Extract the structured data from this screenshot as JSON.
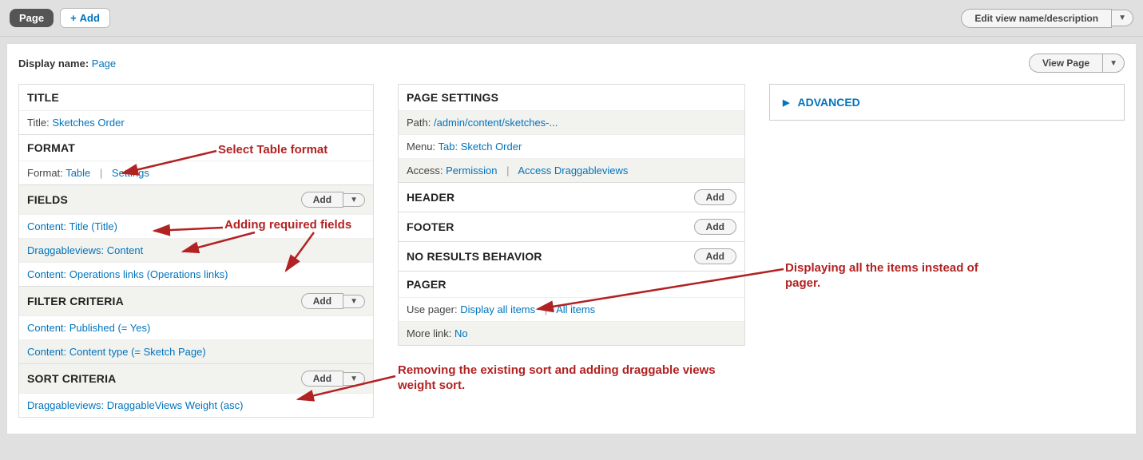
{
  "top": {
    "tab": "Page",
    "add": "Add",
    "edit_view": "Edit view name/description"
  },
  "display": {
    "label": "Display name:",
    "value": "Page",
    "view_page": "View Page"
  },
  "left": {
    "title_head": "TITLE",
    "title_label": "Title:",
    "title_value": "Sketches Order",
    "format_head": "FORMAT",
    "format_label": "Format:",
    "format_value": "Table",
    "format_settings": "Settings",
    "fields_head": "FIELDS",
    "fields_add": "Add",
    "fields": [
      "Content: Title (Title)",
      "Draggableviews: Content",
      "Content: Operations links (Operations links)"
    ],
    "filter_head": "FILTER CRITERIA",
    "filter_add": "Add",
    "filters": [
      "Content: Published (= Yes)",
      "Content: Content type (= Sketch Page)"
    ],
    "sort_head": "SORT CRITERIA",
    "sort_add": "Add",
    "sorts": [
      "Draggableviews: DraggableViews Weight (asc)"
    ]
  },
  "middle": {
    "page_head": "PAGE SETTINGS",
    "path_label": "Path:",
    "path_value": "/admin/content/sketches-...",
    "menu_label": "Menu:",
    "menu_value": "Tab: Sketch Order",
    "access_label": "Access:",
    "access_value": "Permission",
    "access_link": "Access Draggableviews",
    "header_head": "HEADER",
    "footer_head": "FOOTER",
    "noresults_head": "NO RESULTS BEHAVIOR",
    "pager_head": "PAGER",
    "use_pager_label": "Use pager:",
    "use_pager_value": "Display all items",
    "use_pager_link": "All items",
    "more_label": "More link:",
    "more_value": "No",
    "add": "Add"
  },
  "right": {
    "advanced": "ADVANCED"
  },
  "annotations": {
    "a1": "Select Table format",
    "a2": "Adding required fields",
    "a3": "Removing the existing sort and adding draggable views weight sort.",
    "a4": "Displaying all the items instead of pager."
  }
}
